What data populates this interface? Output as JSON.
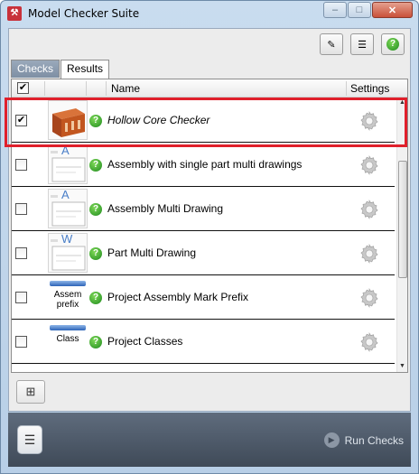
{
  "window": {
    "title": "Model Checker Suite",
    "minimize_glyph": "–",
    "maximize_glyph": "□",
    "close_glyph": "✕"
  },
  "toolbar": {
    "pin_glyph": "✎",
    "list_glyph": "☰",
    "help_glyph": "?"
  },
  "tabs": [
    "Checks",
    "Results"
  ],
  "grid": {
    "columns": [
      "Name",
      "Settings"
    ],
    "header_checked": true,
    "rows": [
      {
        "name": "Hollow Core Checker",
        "checked": true,
        "italic": true,
        "thumb": "hollow-core",
        "thumb_label": ""
      },
      {
        "name": "Assembly with single part multi drawings",
        "checked": false,
        "italic": false,
        "thumb": "drawing",
        "thumb_label": "A"
      },
      {
        "name": "Assembly Multi Drawing",
        "checked": false,
        "italic": false,
        "thumb": "drawing",
        "thumb_label": "A"
      },
      {
        "name": "Part Multi Drawing",
        "checked": false,
        "italic": false,
        "thumb": "drawing",
        "thumb_label": "W"
      },
      {
        "name": "Project Assembly Mark Prefix",
        "checked": false,
        "italic": false,
        "thumb": "text",
        "thumb_label": "Assem prefix"
      },
      {
        "name": "Project Classes",
        "checked": false,
        "italic": false,
        "thumb": "text",
        "thumb_label": "Class"
      }
    ]
  },
  "footer": {
    "run_label": "Run Checks"
  },
  "colors": {
    "highlight": "#e0202b",
    "status_green": "#1f8a1f",
    "footer_bg": "#4d5968"
  }
}
